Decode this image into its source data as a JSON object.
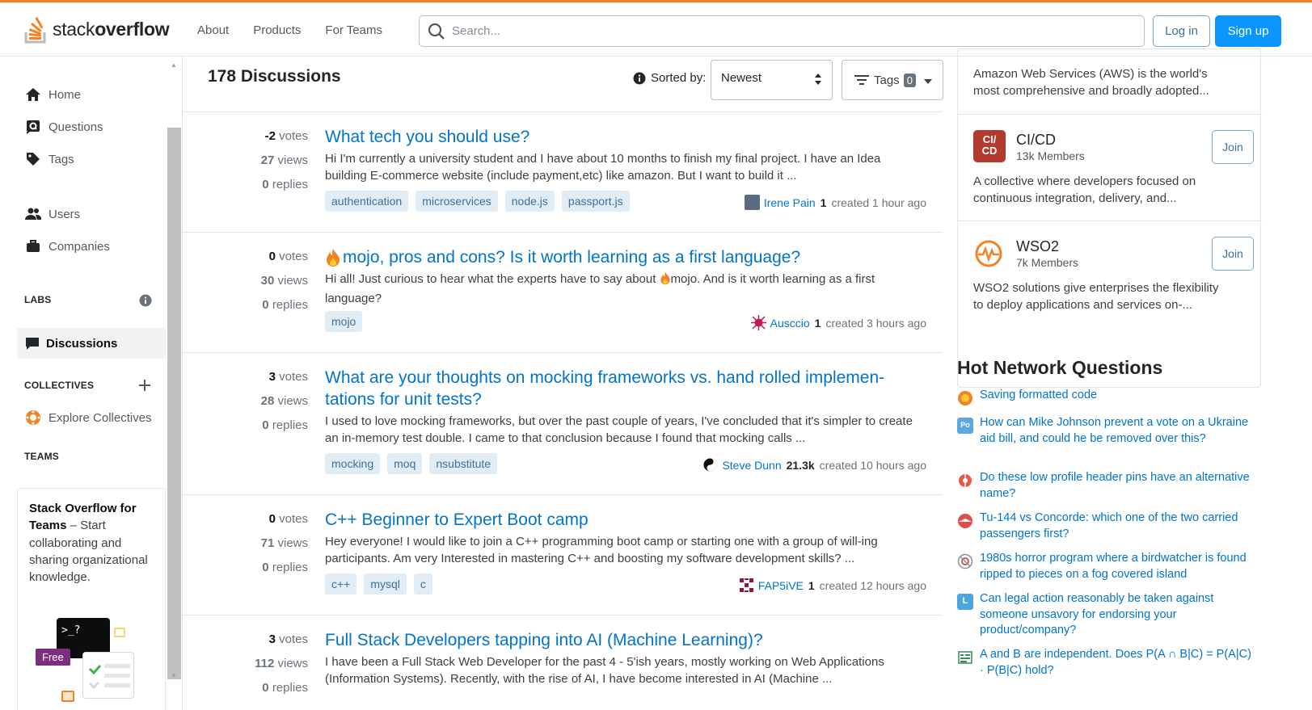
{
  "header": {
    "logo_text_light": "stack",
    "logo_text_bold": "overflow",
    "nav": [
      "About",
      "Products",
      "For Teams"
    ],
    "search_placeholder": "Search...",
    "login": "Log in",
    "signup": "Sign up"
  },
  "sidebar": {
    "items": [
      {
        "label": "Home",
        "icon": "home-icon"
      },
      {
        "label": "Questions",
        "icon": "questions-icon"
      },
      {
        "label": "Tags",
        "icon": "tag-icon"
      },
      {
        "label": "Users",
        "icon": "users-icon"
      },
      {
        "label": "Companies",
        "icon": "briefcase-icon"
      }
    ],
    "labs_title": "LABS",
    "discussions": "Discussions",
    "collectives_title": "COLLECTIVES",
    "explore_collectives": "Explore Collectives",
    "teams_title": "TEAMS",
    "teams_heading": "Stack Overflow for Teams",
    "teams_body": " – Start collaborating and sharing organizational knowledge.",
    "free_badge": "Free",
    "terminal_text": ">_?"
  },
  "main": {
    "count_label": "178 Discussions",
    "sorted_label": "Sorted by:",
    "sort_value": "Newest",
    "tags_label": "Tags",
    "tags_count": "0",
    "posts": [
      {
        "votes": "-2",
        "views": "27",
        "replies": "0",
        "title": "What tech you should use?",
        "excerpt": "Hi I'm currently a university student and I have about 10 months to finish my final project. I have an Idea building E-commerce website (include payment,etc) like amazon. But I want to build it ...",
        "tags": [
          "authentication",
          "microservices",
          "node.js",
          "passport.js"
        ],
        "user": "Irene Pain",
        "rep": "1",
        "ago": "created 1 hour ago"
      },
      {
        "votes": "0",
        "views": "30",
        "replies": "0",
        "title": "mojo, pros and cons? Is it worth learning as a first language?",
        "excerpt_a": "Hi all! Just curious to hear what the experts have to say about ",
        "excerpt_b": "mojo. And is it worth learning as a first language?",
        "tags": [
          "mojo"
        ],
        "user": "Ausccio",
        "rep": "1",
        "ago": "created 3 hours ago"
      },
      {
        "votes": "3",
        "views": "28",
        "replies": "0",
        "title": "What are your thoughts on mocking frameworks vs. hand rolled implemen-tations for unit tests?",
        "excerpt": "I used to love mocking frameworks, but over the past couple of years, I've concluded that it's simpler to create an in-memory test double. I came to that conclusion because I found that mocking calls ...",
        "tags": [
          "mocking",
          "moq",
          "nsubstitute"
        ],
        "user": "Steve Dunn",
        "rep": "21.3k",
        "ago": "created 10 hours ago"
      },
      {
        "votes": "0",
        "views": "71",
        "replies": "0",
        "title": "C++ Beginner to Expert Boot camp",
        "excerpt": "Hey everyone! I would like to join a C++ programming boot camp or starting one with a group of will-ing participants. Am very Interested in mastering C++ and boosting my software development skills? ...",
        "tags": [
          "c++",
          "mysql",
          "c"
        ],
        "user": "FAP5iVE",
        "rep": "1",
        "ago": "created 12 hours ago"
      },
      {
        "votes": "3",
        "views": "112",
        "replies": "0",
        "title": "Full Stack Developers tapping into AI (Machine Learning)?",
        "excerpt": "I have been a Full Stack Web Developer for the past 4 - 5'ish years, mostly working on Web Applications (Information Systems). Recently, with the rise of AI, I have become interested in AI (Machine ...",
        "tags": [],
        "user": "",
        "rep": "",
        "ago": ""
      }
    ],
    "votes_word": "votes",
    "views_word": "views",
    "replies_word": "replies"
  },
  "collectives": [
    {
      "name": "",
      "members": "",
      "desc": "Amazon Web Services (AWS) is the world's most comprehensive and broadly adopted..."
    },
    {
      "name": "CI/CD",
      "members": "13k Members",
      "desc": "A collective where developers focused on continuous integration, delivery, and...",
      "join": "Join",
      "logo_text": "CI/ CD"
    },
    {
      "name": "WSO2",
      "members": "7k Members",
      "desc": "WSO2 solutions give enterprises the flexibility to deploy applications and services on-...",
      "join": "Join"
    }
  ],
  "hot_network": {
    "title": "Hot Network Questions",
    "items": [
      "Saving formatted code",
      "How can Mike Johnson prevent a vote on a Ukraine aid bill, and could he be removed over this?",
      "Do these low profile header pins have an alternative name?",
      "Tu-144 vs Concorde: which one of the two carried passengers first?",
      "1980s horror program where a birdwatcher is found ripped to pieces on a fog covered island",
      "Can legal action reasonably be taken against someone unsavory for endorsing your product/company?",
      "A and B are independent. Does P(A ∩ B|C) = P(A|C) · P(B|C) hold?"
    ],
    "site_label_po": "Po",
    "site_label_l": "L"
  },
  "colors": {
    "accent": "#f48225",
    "link": "#0074cc",
    "primary": "#0a95ff",
    "tag_bg": "#e1ecf4",
    "tag_fg": "#39739d"
  }
}
